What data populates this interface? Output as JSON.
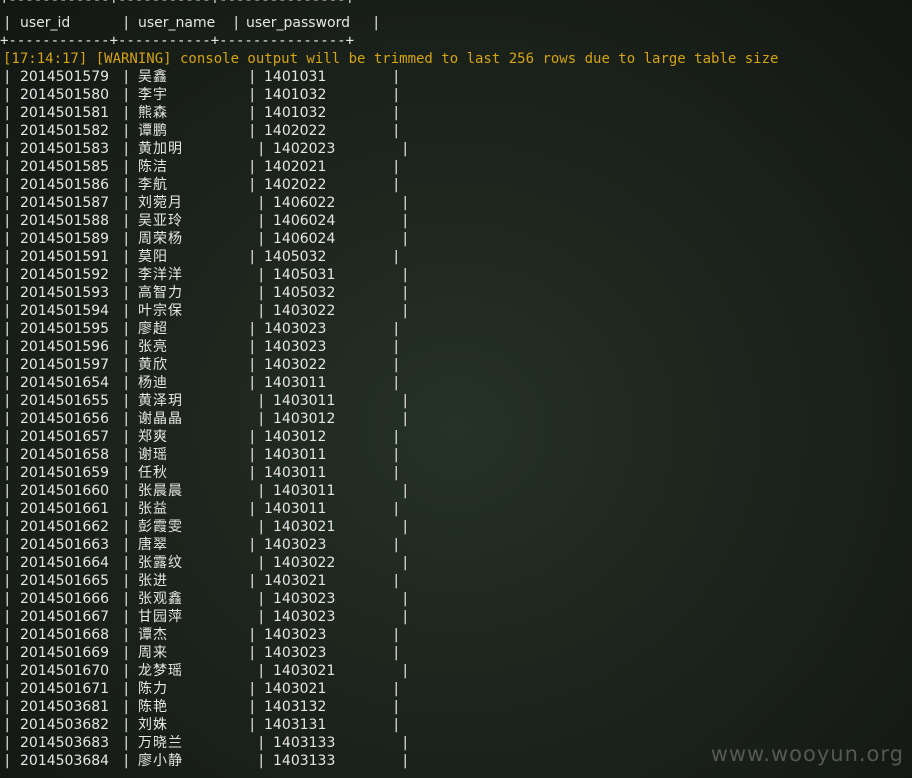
{
  "table": {
    "border_line": "+------------+-----------+---------------+",
    "columns": [
      "user_id",
      "user_name",
      "user_password"
    ],
    "pipe": "|",
    "rows": [
      {
        "id": "2014501579",
        "name": "吴鑫",
        "password": "1401031"
      },
      {
        "id": "2014501580",
        "name": "李宇",
        "password": "1401032"
      },
      {
        "id": "2014501581",
        "name": "熊森",
        "password": "1401032"
      },
      {
        "id": "2014501582",
        "name": "谭鹏",
        "password": "1402022"
      },
      {
        "id": "2014501583",
        "name": "黄加明",
        "password": "1402023"
      },
      {
        "id": "2014501585",
        "name": "陈洁",
        "password": "1402021"
      },
      {
        "id": "2014501586",
        "name": "李航",
        "password": "1402022"
      },
      {
        "id": "2014501587",
        "name": "刘菀月",
        "password": "1406022"
      },
      {
        "id": "2014501588",
        "name": "吴亚玲",
        "password": "1406024"
      },
      {
        "id": "2014501589",
        "name": "周荣杨",
        "password": "1406024"
      },
      {
        "id": "2014501591",
        "name": "莫阳",
        "password": "1405032"
      },
      {
        "id": "2014501592",
        "name": "李洋洋",
        "password": "1405031"
      },
      {
        "id": "2014501593",
        "name": "高智力",
        "password": "1405032"
      },
      {
        "id": "2014501594",
        "name": "叶宗保",
        "password": "1403022"
      },
      {
        "id": "2014501595",
        "name": "廖超",
        "password": "1403023"
      },
      {
        "id": "2014501596",
        "name": "张亮",
        "password": "1403023"
      },
      {
        "id": "2014501597",
        "name": "黄欣",
        "password": "1403022"
      },
      {
        "id": "2014501654",
        "name": "杨迪",
        "password": "1403011"
      },
      {
        "id": "2014501655",
        "name": "黄泽玥",
        "password": "1403011"
      },
      {
        "id": "2014501656",
        "name": "谢晶晶",
        "password": "1403012"
      },
      {
        "id": "2014501657",
        "name": "郑爽",
        "password": "1403012"
      },
      {
        "id": "2014501658",
        "name": "谢瑶",
        "password": "1403011"
      },
      {
        "id": "2014501659",
        "name": "任秋",
        "password": "1403011"
      },
      {
        "id": "2014501660",
        "name": "张晨晨",
        "password": "1403011"
      },
      {
        "id": "2014501661",
        "name": "张益",
        "password": "1403011"
      },
      {
        "id": "2014501662",
        "name": "彭霞雯",
        "password": "1403021"
      },
      {
        "id": "2014501663",
        "name": "唐翠",
        "password": "1403023"
      },
      {
        "id": "2014501664",
        "name": "张露纹",
        "password": "1403022"
      },
      {
        "id": "2014501665",
        "name": "张进",
        "password": "1403021"
      },
      {
        "id": "2014501666",
        "name": "张观鑫",
        "password": "1403023"
      },
      {
        "id": "2014501667",
        "name": "甘园萍",
        "password": "1403023"
      },
      {
        "id": "2014501668",
        "name": "谭杰",
        "password": "1403023"
      },
      {
        "id": "2014501669",
        "name": "周来",
        "password": "1403023"
      },
      {
        "id": "2014501670",
        "name": "龙梦瑶",
        "password": "1403021"
      },
      {
        "id": "2014501671",
        "name": "陈力",
        "password": "1403021"
      },
      {
        "id": "2014503681",
        "name": "陈艳",
        "password": "1403132"
      },
      {
        "id": "2014503682",
        "name": "刘姝",
        "password": "1403131"
      },
      {
        "id": "2014503683",
        "name": "万晓兰",
        "password": "1403133"
      },
      {
        "id": "2014503684",
        "name": "廖小静",
        "password": "1403133"
      }
    ]
  },
  "warning": {
    "text": "[17:14:17] [WARNING] console output will be trimmed to last 256 rows due to large table size"
  },
  "watermark": "www.wooyun.org",
  "colors": {
    "warning": "#d4a412",
    "text": "#e6e6e6",
    "background": "#1d241d"
  }
}
